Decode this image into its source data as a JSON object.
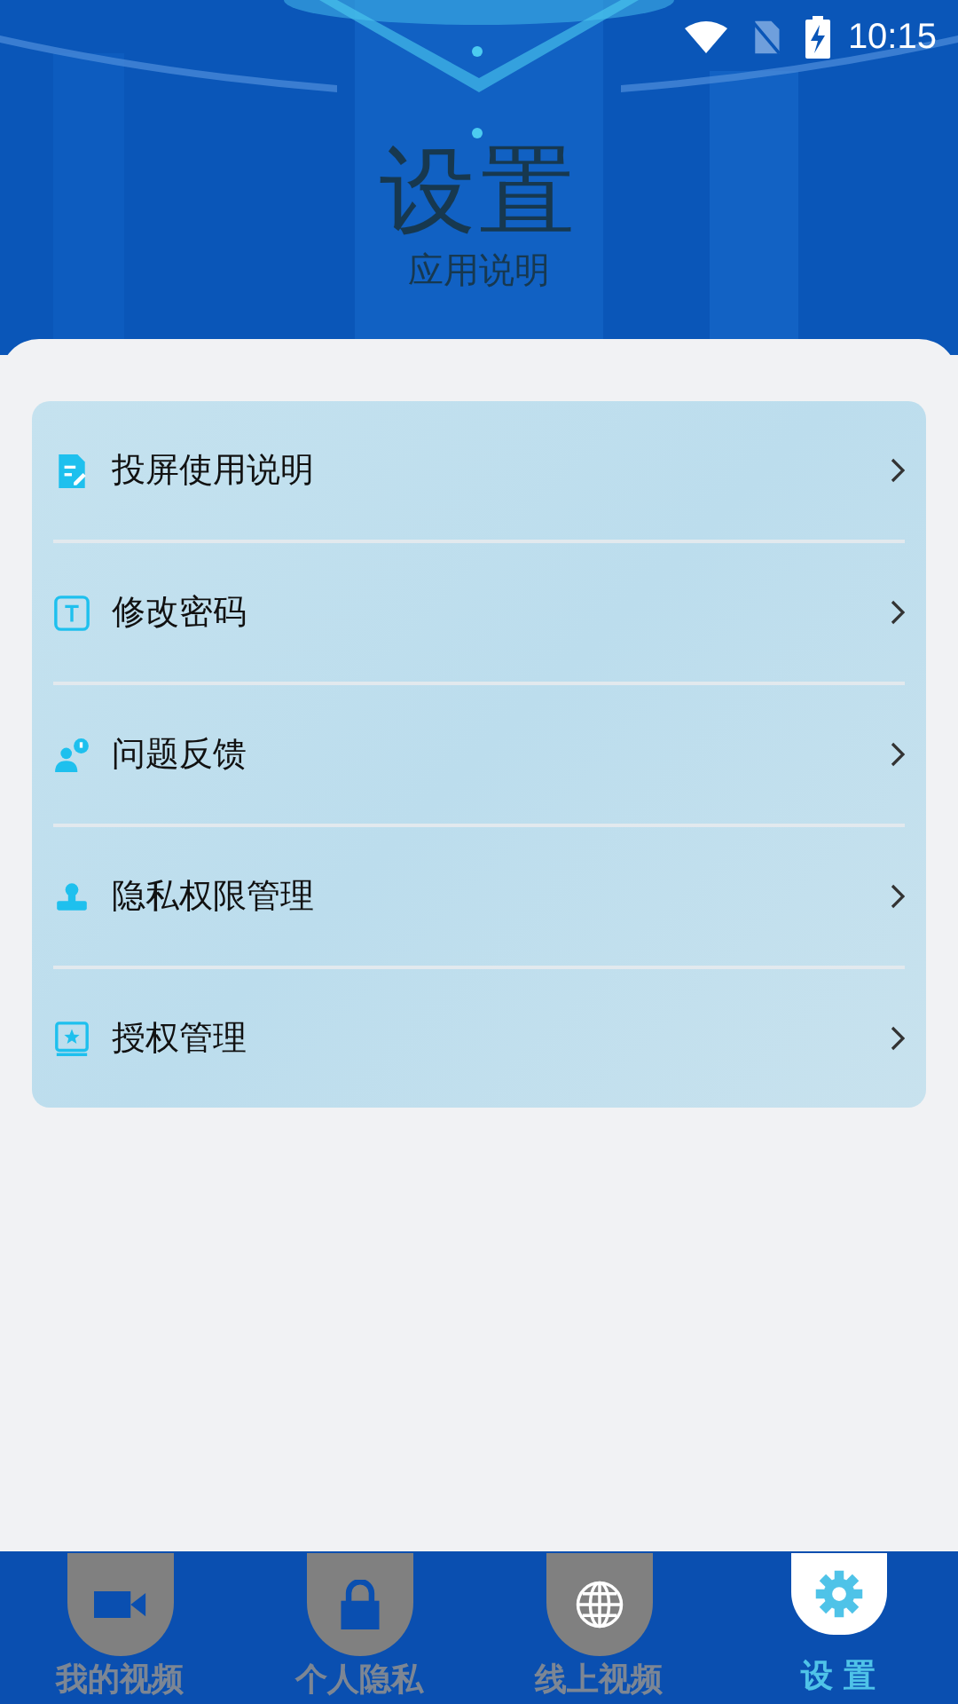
{
  "status_bar": {
    "time": "10:15"
  },
  "header": {
    "title": "设置",
    "subtitle": "应用说明"
  },
  "menu": [
    {
      "label": "投屏使用说明",
      "kind": "doc"
    },
    {
      "label": "修改密码",
      "kind": "text"
    },
    {
      "label": "问题反馈",
      "kind": "feedback"
    },
    {
      "label": "隐私权限管理",
      "kind": "stamp"
    },
    {
      "label": "授权管理",
      "kind": "book"
    }
  ],
  "tabs": [
    {
      "label": "我的视频",
      "kind": "video",
      "selected": false
    },
    {
      "label": "个人隐私",
      "kind": "lock",
      "selected": false
    },
    {
      "label": "线上视频",
      "kind": "globe",
      "selected": false
    },
    {
      "label": "设 置",
      "kind": "gear",
      "selected": true
    }
  ]
}
